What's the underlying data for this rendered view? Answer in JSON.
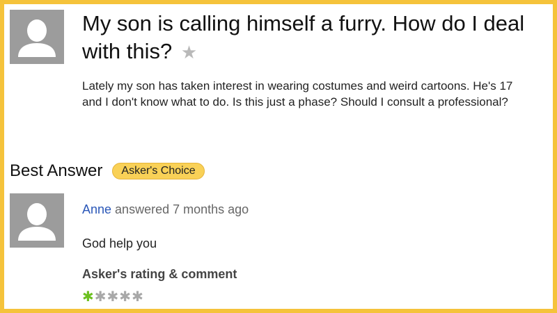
{
  "question": {
    "title": "My son is calling himself a furry. How do I deal with this?",
    "body": "Lately my son has taken interest in wearing costumes and weird cartoons. He's 17 and I don't know what to do. Is this just a phase? Should I consult a professional?",
    "star_glyph": "★"
  },
  "best_answer": {
    "label": "Best Answer",
    "badge": "Asker's Choice"
  },
  "answer": {
    "author": "Anne",
    "meta": " answered 7 months ago",
    "text": "God help you"
  },
  "rating": {
    "heading": "Asker's rating & comment",
    "value": 1,
    "max": 5,
    "glyph": "✱"
  },
  "colors": {
    "frame": "#f5c33b",
    "author_link": "#2a57b8",
    "rating_filled": "#6cc020",
    "rating_empty": "#a8a8a8",
    "badge": "#f9d157",
    "avatar_bg": "#9c9c9c"
  },
  "icons": {
    "question_avatar": "user-silhouette-icon",
    "answer_avatar": "user-silhouette-icon",
    "favorite": "star-icon"
  }
}
